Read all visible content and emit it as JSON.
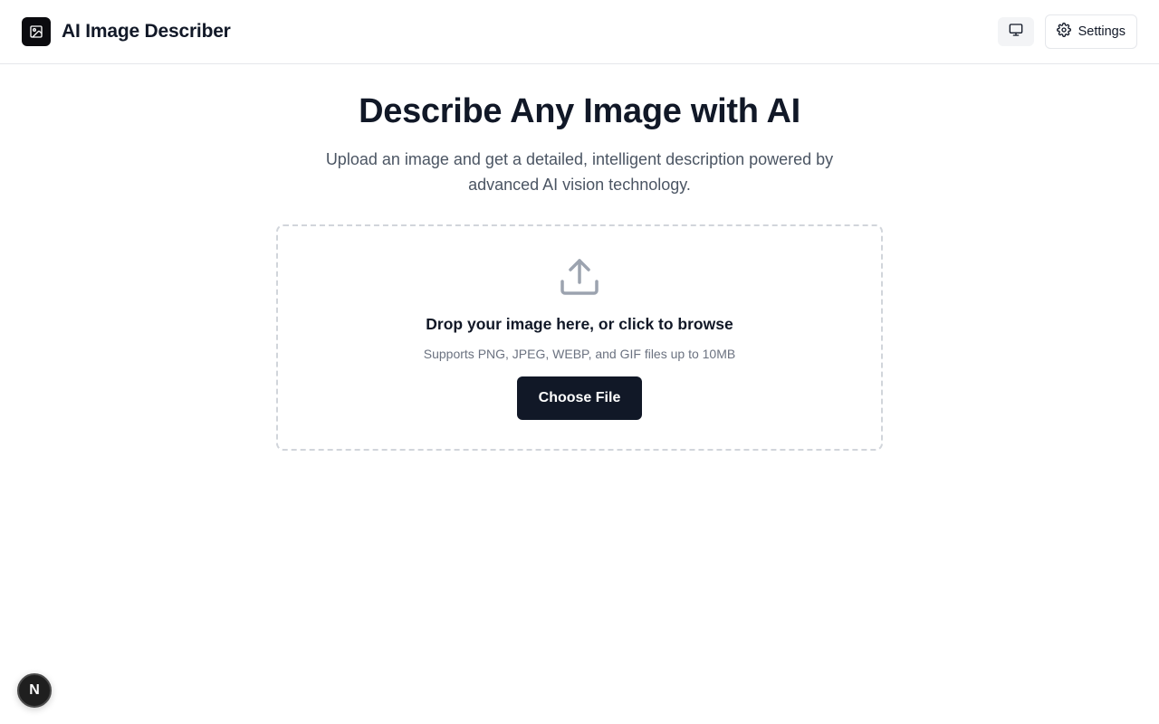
{
  "header": {
    "title": "AI Image Describer",
    "logo_icon": "image-icon",
    "display_icon": "monitor-icon",
    "settings_label": "Settings",
    "settings_icon": "gear-icon"
  },
  "hero": {
    "title": "Describe Any Image with AI",
    "subtitle": "Upload an image and get a detailed, intelligent description powered by advanced AI vision technology."
  },
  "upload": {
    "icon": "upload-icon",
    "title": "Drop your image here, or click to browse",
    "hint": "Supports PNG, JPEG, WEBP, and GIF files up to 10MB",
    "button_label": "Choose File"
  },
  "dev_badge": {
    "label": "N"
  },
  "colors": {
    "primary": "#111827",
    "muted_text": "#6b7280",
    "border": "#e5e7eb"
  }
}
